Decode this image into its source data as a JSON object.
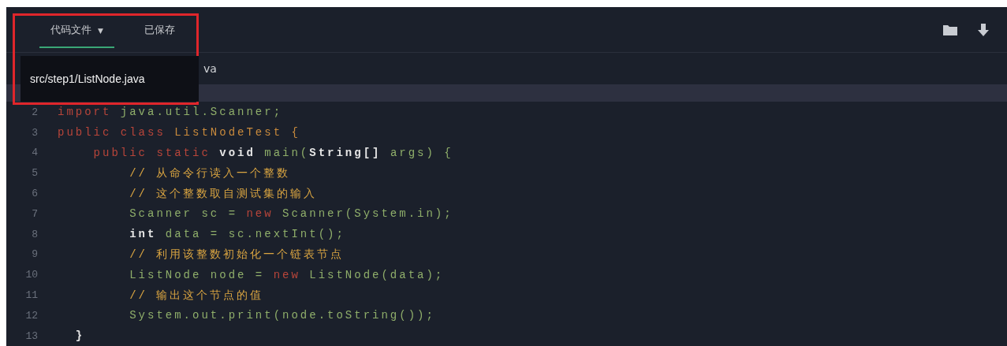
{
  "tabs": [
    {
      "label": "代码文件",
      "dropdown": "▼",
      "selected": true
    },
    {
      "label": "已保存",
      "selected": false
    }
  ],
  "file_path": "va",
  "file_menu": {
    "items": [
      {
        "label": "src/step1/ListNode.java",
        "selected": false
      }
    ]
  },
  "code_lines": [
    {
      "number": "2",
      "tokens": [
        {
          "text": "import ",
          "kind": "keyword"
        },
        {
          "text": "java.util.Scanner;",
          "kind": "ident"
        }
      ]
    },
    {
      "number": "3",
      "tokens": [
        {
          "text": "public class ",
          "kind": "keyword"
        },
        {
          "text": "ListNodeTest {",
          "kind": "classname"
        }
      ]
    },
    {
      "number": "4",
      "tokens": [
        {
          "text": "    public static ",
          "kind": "keyword"
        },
        {
          "text": "void ",
          "kind": "plain"
        },
        {
          "text": "main(",
          "kind": "ident"
        },
        {
          "text": "String[] ",
          "kind": "plain"
        },
        {
          "text": "args) {",
          "kind": "ident"
        }
      ]
    },
    {
      "number": "5",
      "tokens": [
        {
          "text": "        // 从命令行读入一个整数",
          "kind": "comment"
        }
      ]
    },
    {
      "number": "6",
      "tokens": [
        {
          "text": "        // 这个整数取自测试集的输入",
          "kind": "comment"
        }
      ]
    },
    {
      "number": "7",
      "tokens": [
        {
          "text": "        Scanner sc = ",
          "kind": "ident"
        },
        {
          "text": "new ",
          "kind": "keyword"
        },
        {
          "text": "Scanner(System.in);",
          "kind": "ident"
        }
      ]
    },
    {
      "number": "8",
      "tokens": [
        {
          "text": "        int ",
          "kind": "plain"
        },
        {
          "text": "data = sc.nextInt();",
          "kind": "ident"
        }
      ]
    },
    {
      "number": "9",
      "tokens": [
        {
          "text": "        // 利用该整数初始化一个链表节点",
          "kind": "comment"
        }
      ]
    },
    {
      "number": "10",
      "tokens": [
        {
          "text": "        ListNode node = ",
          "kind": "ident"
        },
        {
          "text": "new ",
          "kind": "keyword"
        },
        {
          "text": "ListNode(data);",
          "kind": "ident"
        }
      ]
    },
    {
      "number": "11",
      "tokens": [
        {
          "text": "        // 输出这个节点的值",
          "kind": "comment"
        }
      ]
    },
    {
      "number": "12",
      "tokens": [
        {
          "text": "        System.out.print(node.toString());",
          "kind": "ident"
        }
      ]
    },
    {
      "number": "13",
      "tokens": [
        {
          "text": "  }",
          "kind": "plain"
        }
      ]
    }
  ]
}
